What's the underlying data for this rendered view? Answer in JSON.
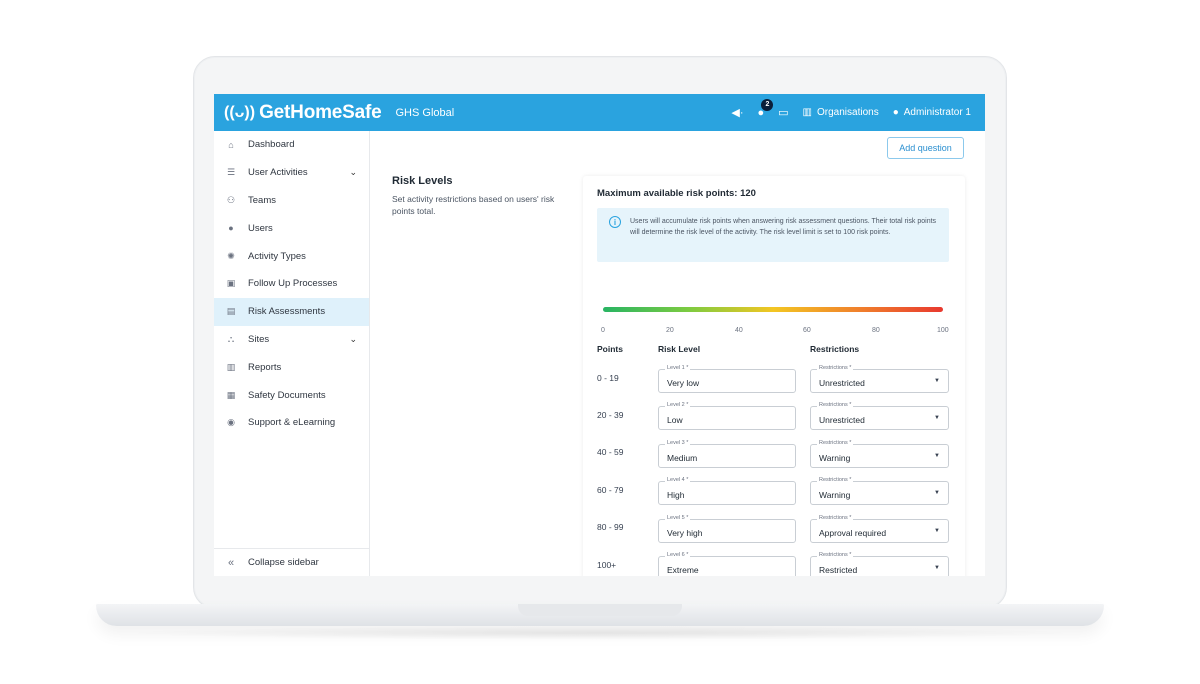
{
  "header": {
    "logo_mark": "((ᴗ))",
    "logo_text": "GetHomeSafe",
    "org_name": "GHS Global",
    "notification_count": "2",
    "organisations_label": "Organisations",
    "user_label": "Administrator 1"
  },
  "sidebar": {
    "items": [
      {
        "label": "Dashboard",
        "icon": "home-icon",
        "glyph": "⌂"
      },
      {
        "label": "User Activities",
        "icon": "list-icon",
        "glyph": "☰"
      },
      {
        "label": "Teams",
        "icon": "teams-icon",
        "glyph": "⚇"
      },
      {
        "label": "Users",
        "icon": "user-icon",
        "glyph": "●"
      },
      {
        "label": "Activity Types",
        "icon": "activity-icon",
        "glyph": "✺"
      },
      {
        "label": "Follow Up Processes",
        "icon": "clipboard-icon",
        "glyph": "▣"
      },
      {
        "label": "Risk Assessments",
        "icon": "document-icon",
        "glyph": "▤"
      },
      {
        "label": "Sites",
        "icon": "sites-icon",
        "glyph": "⛬"
      },
      {
        "label": "Reports",
        "icon": "reports-icon",
        "glyph": "▥"
      },
      {
        "label": "Safety Documents",
        "icon": "file-icon",
        "glyph": "▦"
      },
      {
        "label": "Support & eLearning",
        "icon": "support-icon",
        "glyph": "◉"
      }
    ],
    "collapse_label": "Collapse sidebar"
  },
  "main": {
    "add_question_label": "Add question",
    "section_title": "Risk Levels",
    "section_desc": "Set activity restrictions based on users' risk points total.",
    "max_points": "Maximum available risk points: 120",
    "info_text": "Users will accumulate risk points when answering risk assessment questions. Their total risk points will determine the risk level of the activity. The risk level limit is set to 100 risk points.",
    "scale": [
      "0",
      "20",
      "40",
      "60",
      "80",
      "100"
    ],
    "columns": {
      "points": "Points",
      "risk_level": "Risk Level",
      "restrictions": "Restrictions"
    },
    "rows": [
      {
        "points": "0 - 19",
        "level_label": "Level 1 *",
        "level": "Very low",
        "restr_label": "Restrictions *",
        "restriction": "Unrestricted"
      },
      {
        "points": "20 - 39",
        "level_label": "Level 2 *",
        "level": "Low",
        "restr_label": "Restrictions *",
        "restriction": "Unrestricted"
      },
      {
        "points": "40 - 59",
        "level_label": "Level 3 *",
        "level": "Medium",
        "restr_label": "Restrictions *",
        "restriction": "Warning"
      },
      {
        "points": "60 - 79",
        "level_label": "Level 4 *",
        "level": "High",
        "restr_label": "Restrictions *",
        "restriction": "Warning"
      },
      {
        "points": "80 - 99",
        "level_label": "Level 5 *",
        "level": "Very high",
        "restr_label": "Restrictions *",
        "restriction": "Approval required"
      },
      {
        "points": "100+",
        "level_label": "Level 6 *",
        "level": "Extreme",
        "restr_label": "Restrictions *",
        "restriction": "Restricted"
      }
    ]
  },
  "colors": {
    "brand": "#2aa3df",
    "active_bg": "#dff1fb"
  }
}
